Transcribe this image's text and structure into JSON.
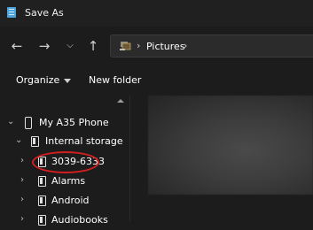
{
  "window": {
    "title": "Save As"
  },
  "nav": {
    "back_icon": "arrow-left-icon",
    "forward_icon": "arrow-right-icon",
    "recent_icon": "chevron-down-icon",
    "up_icon": "arrow-up-icon"
  },
  "address": {
    "location": "Pictures",
    "separator": "›"
  },
  "toolbar": {
    "organize": "Organize",
    "new_folder": "New folder"
  },
  "tree": {
    "phone": "My A35 Phone",
    "storage": "Internal storage",
    "items": [
      {
        "label": "3039-6333"
      },
      {
        "label": "Alarms"
      },
      {
        "label": "Android"
      },
      {
        "label": "Audiobooks"
      }
    ]
  },
  "colors": {
    "background": "#1c1c1c",
    "highlight": "#d21f1f",
    "accent": "#4ea3dc"
  }
}
